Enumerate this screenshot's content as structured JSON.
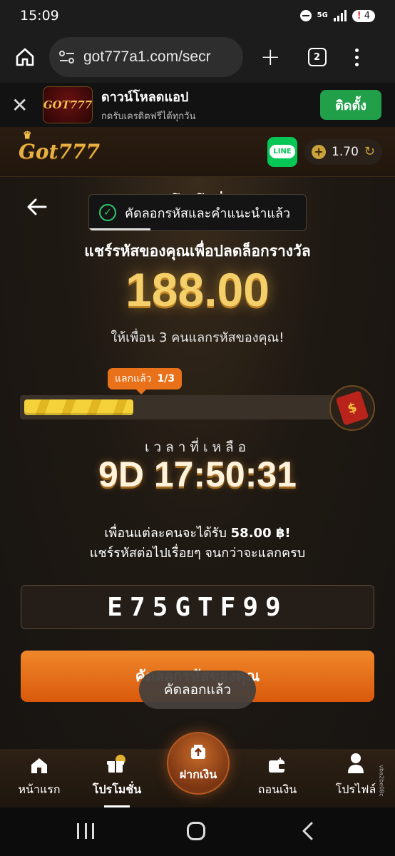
{
  "status_bar": {
    "time": "15:09",
    "network": "5G",
    "notification_count": "4",
    "notification_mark": "!"
  },
  "browser": {
    "url": "got777a1.com/secr",
    "tab_count": "2"
  },
  "download_banner": {
    "logo_text": "GOT777",
    "title": "ดาวน์โหลดแอป",
    "subtitle": "กดรับเครดิตฟรีได้ทุกวัน",
    "install_label": "ติดตั้ง"
  },
  "app_header": {
    "brand": "Got777",
    "line_label": "LINE",
    "balance": "1.70",
    "coin_symbol": "+"
  },
  "main": {
    "title_peek": "โปรโมชั่",
    "toast_top": "คัดลอกรหัสและคำแนะนำแล้ว",
    "heading": "แชร์รหัสของคุณเพื่อปลดล็อกรางวัล",
    "reward_amount": "188.00",
    "invite_text": "ให้เพื่อน 3 คนแลกรหัสของคุณ!",
    "redeem_badge_label": "แลกแล้ว",
    "redeem_badge_count": "1/3",
    "progress_fraction": 0.3333,
    "envelope_symbol": "$",
    "time_left_label": "เวลาที่เหลือ",
    "countdown": "9D 17:50:31",
    "each_friend_prefix": "เพื่อนแต่ละคนจะได้รับ",
    "each_friend_amount": "58.00 ฿!",
    "keep_sharing": "แชร์รหัสต่อไปเรื่อยๆ จนกว่าจะแลกครบ",
    "invite_code": "E75GTF99",
    "copy_button_label": "คัดลอกรหัสของคุณ",
    "toast_bottom": "คัดลอกแล้ว"
  },
  "bottom_nav": {
    "items": [
      {
        "label": "หน้าแรก",
        "icon": "home-icon"
      },
      {
        "label": "โปรโมชั่น",
        "icon": "gift-icon"
      },
      {
        "label": "ฝากเงิน",
        "icon": "deposit-icon"
      },
      {
        "label": "ถอนเงิน",
        "icon": "wallet-icon"
      },
      {
        "label": "โปรไฟล์",
        "icon": "user-icon"
      }
    ],
    "active_index": 1
  },
  "side_tag": "vba2be08c",
  "colors": {
    "accent_orange": "#e8711a",
    "gold": "#f4cf6a",
    "install_green": "#21a049",
    "line_green": "#06c755"
  }
}
